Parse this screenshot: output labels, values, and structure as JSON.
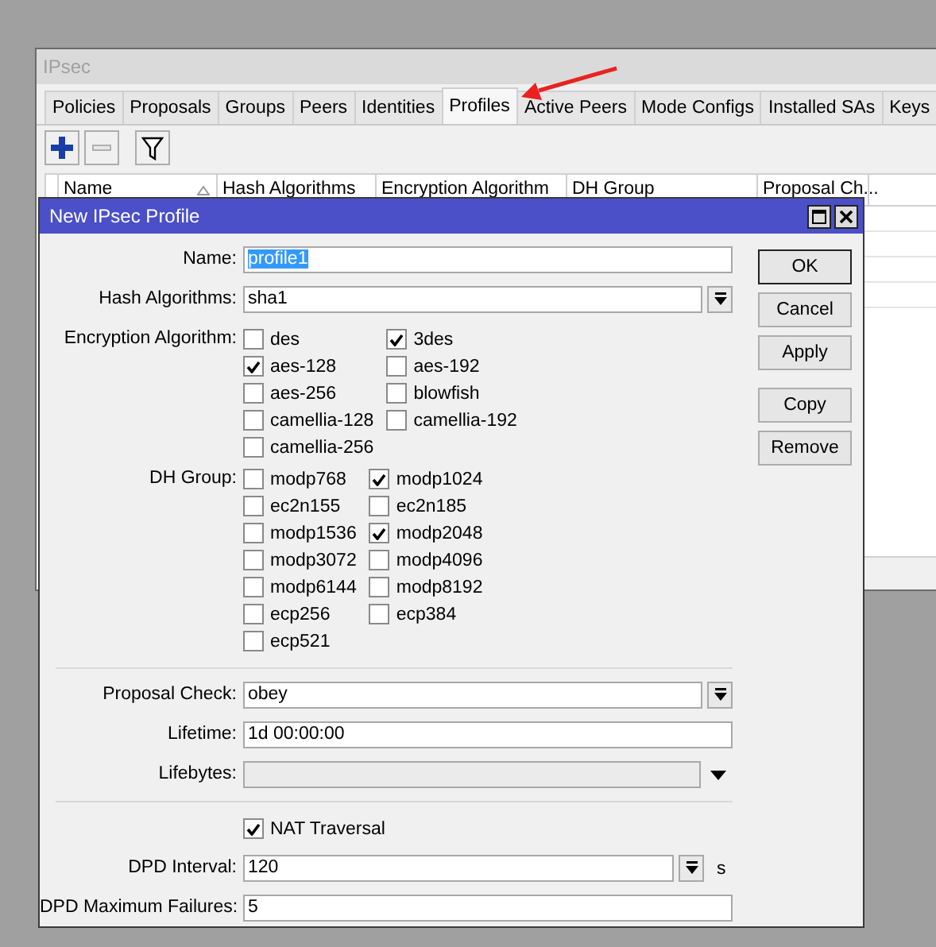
{
  "window": {
    "title": "IPsec"
  },
  "tabs": [
    {
      "label": "Policies",
      "selected": false
    },
    {
      "label": "Proposals",
      "selected": false
    },
    {
      "label": "Groups",
      "selected": false
    },
    {
      "label": "Peers",
      "selected": false
    },
    {
      "label": "Identities",
      "selected": false
    },
    {
      "label": "Profiles",
      "selected": true
    },
    {
      "label": "Active Peers",
      "selected": false
    },
    {
      "label": "Mode Configs",
      "selected": false
    },
    {
      "label": "Installed SAs",
      "selected": false
    },
    {
      "label": "Keys",
      "selected": false
    }
  ],
  "table": {
    "columns": [
      "Name",
      "Hash Algorithms",
      "Encryption Algorithm",
      "DH Group",
      "Proposal Ch..."
    ]
  },
  "dialog": {
    "title": "New IPsec Profile",
    "fields": [
      {
        "kind": "text",
        "label": "Name:",
        "value": "profile1",
        "selected": true
      },
      {
        "kind": "select",
        "label": "Hash Algorithms:",
        "value": "sha1"
      },
      {
        "kind": "checks",
        "label": "Encryption Algorithm:",
        "options": [
          {
            "label": "des",
            "checked": false
          },
          {
            "label": "3des",
            "checked": true
          },
          {
            "label": "aes-128",
            "checked": true
          },
          {
            "label": "aes-192",
            "checked": false
          },
          {
            "label": "aes-256",
            "checked": false
          },
          {
            "label": "blowfish",
            "checked": false
          },
          {
            "label": "camellia-128",
            "checked": false
          },
          {
            "label": "camellia-192",
            "checked": false
          },
          {
            "label": "camellia-256",
            "checked": false
          }
        ]
      },
      {
        "kind": "checks",
        "label": "DH Group:",
        "options": [
          {
            "label": "modp768",
            "checked": false
          },
          {
            "label": "modp1024",
            "checked": true
          },
          {
            "label": "ec2n155",
            "checked": false
          },
          {
            "label": "ec2n185",
            "checked": false
          },
          {
            "label": "modp1536",
            "checked": false
          },
          {
            "label": "modp2048",
            "checked": true
          },
          {
            "label": "modp3072",
            "checked": false
          },
          {
            "label": "modp4096",
            "checked": false
          },
          {
            "label": "modp6144",
            "checked": false
          },
          {
            "label": "modp8192",
            "checked": false
          },
          {
            "label": "ecp256",
            "checked": false
          },
          {
            "label": "ecp384",
            "checked": false
          },
          {
            "label": "ecp521",
            "checked": false
          }
        ]
      },
      {
        "kind": "separator"
      },
      {
        "kind": "select",
        "label": "Proposal Check:",
        "value": "obey"
      },
      {
        "kind": "text",
        "label": "Lifetime:",
        "value": "1d 00:00:00"
      },
      {
        "kind": "optional",
        "label": "Lifebytes:"
      },
      {
        "kind": "separator"
      },
      {
        "kind": "checkbox",
        "label": "NAT Traversal",
        "checked": true
      },
      {
        "kind": "select",
        "label": "DPD Interval:",
        "value": "120",
        "unit": "s"
      },
      {
        "kind": "text",
        "label": "DPD Maximum Failures:",
        "value": "5"
      }
    ],
    "button_groups": [
      [
        {
          "label": "OK",
          "default": true
        },
        {
          "label": "Cancel",
          "default": false
        },
        {
          "label": "Apply",
          "default": false
        }
      ],
      [
        {
          "label": "Copy",
          "default": false
        },
        {
          "label": "Remove",
          "default": false
        }
      ]
    ]
  }
}
